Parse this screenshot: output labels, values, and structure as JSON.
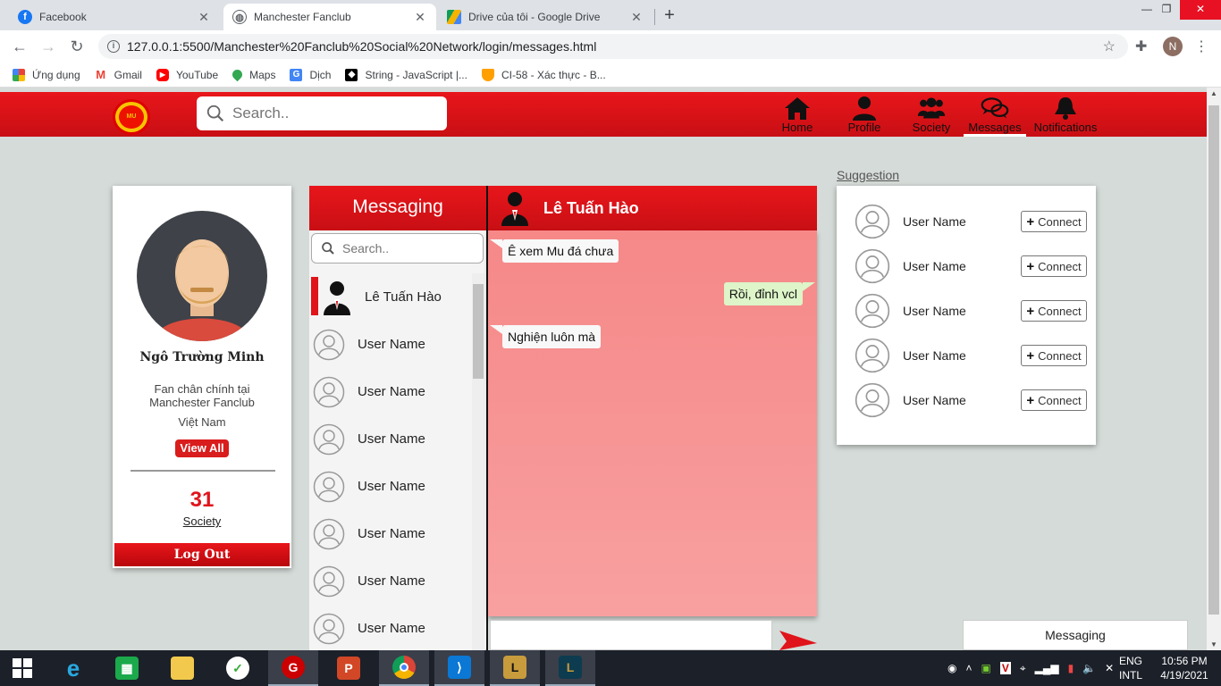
{
  "browser": {
    "tabs": [
      {
        "title": "Facebook",
        "icon": "facebook-icon",
        "color": "#1877f2"
      },
      {
        "title": "Manchester Fanclub",
        "icon": "globe-icon",
        "color": "#5f6368"
      },
      {
        "title": "Drive của tôi - Google Drive",
        "icon": "google-drive-icon",
        "color": "#f4b400"
      }
    ],
    "url": "127.0.0.1:5500/Manchester%20Fanclub%20Social%20Network/login/messages.html",
    "profile_initial": "N",
    "bookmarks": [
      {
        "label": "Ứng dụng",
        "icon": "apps-grid-icon",
        "color": "#ea4335"
      },
      {
        "label": "Gmail",
        "icon": "gmail-icon",
        "color": "#ea4335"
      },
      {
        "label": "YouTube",
        "icon": "youtube-icon",
        "color": "#ff0000"
      },
      {
        "label": "Maps",
        "icon": "maps-icon",
        "color": "#34a853"
      },
      {
        "label": "Dịch",
        "icon": "translate-icon",
        "color": "#4285f4"
      },
      {
        "label": "String - JavaScript |...",
        "icon": "mdn-icon",
        "color": "#000000"
      },
      {
        "label": "CI-58 - Xác thực - B...",
        "icon": "firebase-icon",
        "color": "#ffa000"
      }
    ]
  },
  "site": {
    "search_placeholder": "Search..",
    "nav": [
      {
        "label": "Home",
        "icon": "home-icon"
      },
      {
        "label": "Profile",
        "icon": "user-icon"
      },
      {
        "label": "Society",
        "icon": "users-icon"
      },
      {
        "label": "Messages",
        "icon": "chat-bubbles-icon",
        "active": true
      },
      {
        "label": "Notifications",
        "icon": "bell-icon"
      }
    ],
    "brand_color": "#e0141b"
  },
  "profile": {
    "name": "Ngô Trường Minh",
    "bio": "Fan chân chính tại Manchester Fanclub",
    "country": "Việt Nam",
    "view_all": "View All",
    "society_count": "31",
    "society_label": "Society",
    "logout": "Log Out"
  },
  "messaging": {
    "title": "Messaging",
    "search_placeholder": "Search..",
    "conversations": [
      {
        "name": "Lê Tuấn Hào",
        "active": true
      },
      {
        "name": "User Name"
      },
      {
        "name": "User Name"
      },
      {
        "name": "User Name"
      },
      {
        "name": "User Name"
      },
      {
        "name": "User Name"
      },
      {
        "name": "User Name"
      },
      {
        "name": "User Name"
      }
    ]
  },
  "chat": {
    "contact": "Lê Tuấn Hào",
    "messages": [
      {
        "text": "Ê xem Mu đá chưa",
        "direction": "in"
      },
      {
        "text": "Rồi, đỉnh vcl",
        "direction": "out"
      },
      {
        "text": "Nghiện luôn mà",
        "direction": "in"
      }
    ]
  },
  "suggestion": {
    "title": "Suggestion",
    "users": [
      {
        "name": "User Name",
        "button": "Connect"
      },
      {
        "name": "User Name",
        "button": "Connect"
      },
      {
        "name": "User Name",
        "button": "Connect"
      },
      {
        "name": "User Name",
        "button": "Connect"
      },
      {
        "name": "User Name",
        "button": "Connect"
      }
    ]
  },
  "messaging_popup": "Messaging",
  "taskbar": {
    "lang_top": "ENG",
    "lang_bottom": "INTL",
    "time": "10:56 PM",
    "date": "4/19/2021"
  }
}
